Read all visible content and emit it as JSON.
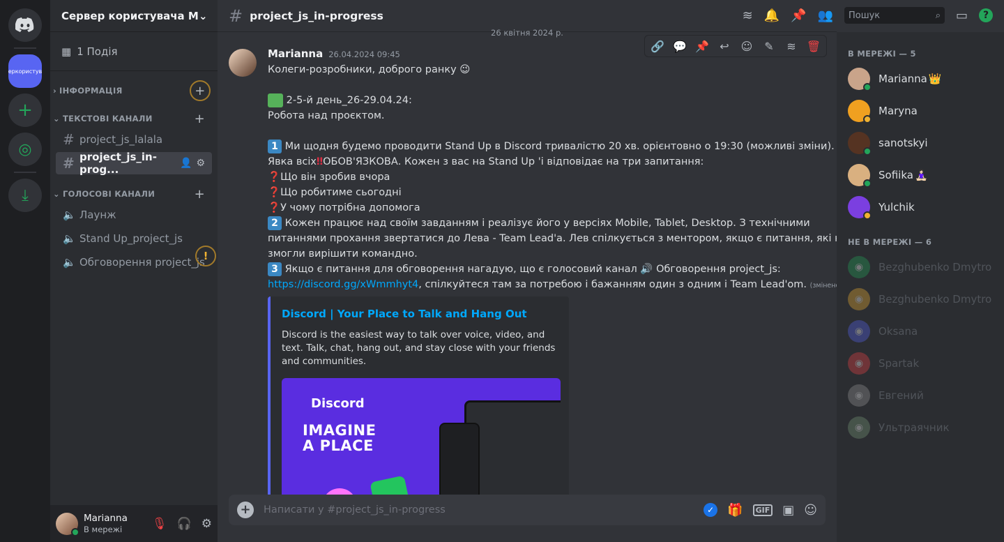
{
  "guilds": {
    "server_label": "еркористув"
  },
  "sidebar": {
    "server_name": "Сервер користувача Ма...",
    "events": "1 Подія",
    "categories": {
      "info": "ІНФОРМАЦІЯ",
      "text": "ТЕКСТОВІ КАНАЛИ",
      "voice": "ГОЛОСОВІ КАНАЛИ"
    },
    "text_channels": [
      "project_js_lalala",
      "project_js_in-prog..."
    ],
    "voice_channels": [
      "Лаунж",
      "Stand Up_project_js",
      "Обговорення project_js"
    ]
  },
  "user_panel": {
    "name": "Marianna",
    "status": "В мережі"
  },
  "topbar": {
    "channel": "project_js_in-progress",
    "search_placeholder": "Пошук"
  },
  "chat": {
    "date_divider": "26 квітня 2024 р.",
    "message": {
      "author": "Marianna",
      "timestamp": "26.04.2024 09:45",
      "line1": "Колеги-розробники, доброго ранку 😉",
      "line2": " 2-5-й день_26-29.04.24:",
      "line3": "Робота над проєктом.",
      "p1": " Ми щодня будемо проводити Stand Up в Discord тривалістю 20 хв. орієнтовно о 19:30 (можливі зміни).",
      "p1b_start": "Явка всіх",
      "p1b_end": "ОБОВ'ЯЗКОВА. Кожен з вас на Stand Up 'і відповідає на три запитання:",
      "q1": "Що він зробив вчора",
      "q2": "Що робитиме сьогодні",
      "q3": "У чому потрібна допомога",
      "p2": " Кожен працює над своїм завданням і реалізує його у версіях Mobile, Tablet, Desktop. З технічними",
      "p2b": "питаннями прохання звертатися до Лева - Team Lead'a. Лев спілкується з ментором, якщо є питання, які не",
      "p2c": "змогли вирішити командно.",
      "p3": " Якщо є питання для обговорення нагадую, що є голосовий канал 🔊 Обговорення project_js:",
      "link": "https://discord.gg/xWmmhyt4",
      "p3_end": ", спілкуйтеся там за потребою і бажанням один з одним і Team Lead'om.",
      "edited": "(змінено)",
      "num1": "1",
      "num2": "2",
      "num3": "3"
    },
    "embed": {
      "title": "Discord | Your Place to Talk and Hang Out",
      "description": "Discord is the easiest way to talk over voice, video, and text. Talk, chat, hang out, and stay close with your friends and communities.",
      "img_logo": "Discord",
      "img_text1": "IMAGINE",
      "img_text2": "A PLACE"
    },
    "composer_placeholder": "Написати у #project_js_in-progress"
  },
  "members": {
    "online_header": "В МЕРЕЖІ — 5",
    "offline_header": "НЕ В МЕРЕЖІ — 6",
    "online": [
      {
        "name": "Marianna",
        "suffix": "👑",
        "color": "#c9a48a",
        "status": "#23a55a"
      },
      {
        "name": "Maryna",
        "suffix": "",
        "color": "#f0a020",
        "status": "#f0b232"
      },
      {
        "name": "sanotskyi",
        "suffix": "",
        "color": "#553322",
        "status": "#23a55a"
      },
      {
        "name": "Sofiika",
        "suffix": "🧘🏻‍♀",
        "color": "#d9b080",
        "status": "#23a55a"
      },
      {
        "name": "Yulchik",
        "suffix": "",
        "color": "#7b3fe0",
        "status": "#f0b232"
      }
    ],
    "offline": [
      {
        "name": "Bezghubenko Dmytro",
        "color": "#23a55a"
      },
      {
        "name": "Bezghubenko Dmytro",
        "color": "#f0b232"
      },
      {
        "name": "Oksana",
        "color": "#5865f2"
      },
      {
        "name": "Spartak",
        "color": "#ed4245"
      },
      {
        "name": "Евгений",
        "color": "#999999"
      },
      {
        "name": "Ультраячник",
        "color": "#7a9a7a"
      }
    ]
  }
}
